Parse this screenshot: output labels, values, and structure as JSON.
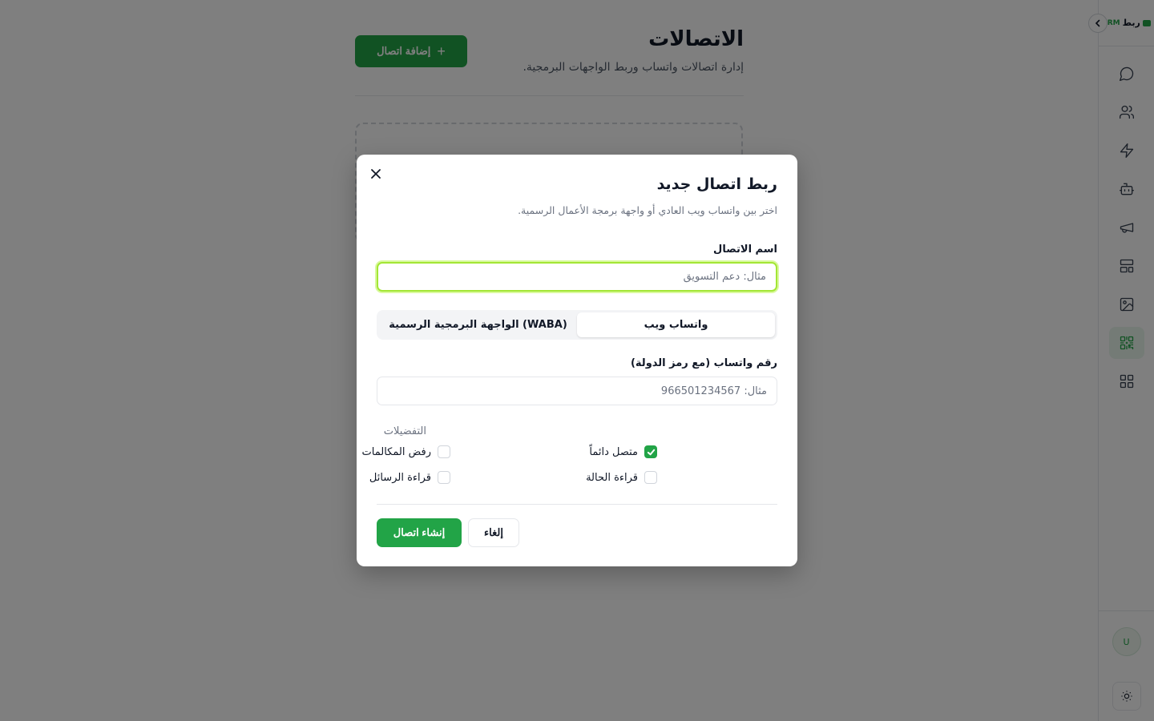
{
  "app": {
    "brand_name": "ربط",
    "brand_suffix": "CRM"
  },
  "sidebar": {
    "items": [
      {
        "icon": "chat-icon"
      },
      {
        "icon": "users-icon"
      },
      {
        "icon": "lightning-icon"
      },
      {
        "icon": "bot-icon"
      },
      {
        "icon": "megaphone-icon"
      },
      {
        "icon": "layout-icon"
      },
      {
        "icon": "gallery-icon"
      },
      {
        "icon": "qr-code-icon",
        "active": true
      },
      {
        "icon": "apps-grid-icon"
      }
    ],
    "avatar_initial": "U"
  },
  "page": {
    "title": "الاتصالات",
    "subtitle": "إدارة اتصالات واتساب وربط الواجهات البرمجية.",
    "add_button": "إضافة اتصال"
  },
  "modal": {
    "title": "ربط اتصال جديد",
    "subtitle": "اختر بين واتساب ويب العادي أو واجهة برمجة الأعمال الرسمية.",
    "name_label": "اسم الاتصال",
    "name_placeholder": "مثال: دعم التسويق",
    "tabs": [
      {
        "label": "واتساب ويب",
        "active": true
      },
      {
        "label": "(WABA) الواجهة البرمجية الرسمية",
        "active": false
      }
    ],
    "phone_label": "رقم واتساب (مع رمز الدولة)",
    "phone_placeholder": "مثال: 966501234567",
    "preferences_label": "التفضيلات",
    "preferences": {
      "always_online": {
        "label": "متصل دائماً",
        "checked": true
      },
      "reject_calls": {
        "label": "رفض المكالمات",
        "checked": false
      },
      "read_status": {
        "label": "قراءة الحالة",
        "checked": false
      },
      "read_messages": {
        "label": "قراءة الرسائل",
        "checked": false
      }
    },
    "create_button": "إنشاء اتصال",
    "cancel_button": "إلغاء"
  },
  "colors": {
    "accent": "#22a447",
    "focus_ring": "#a3e635",
    "overlay": "rgba(0,0,0,0.5)"
  }
}
